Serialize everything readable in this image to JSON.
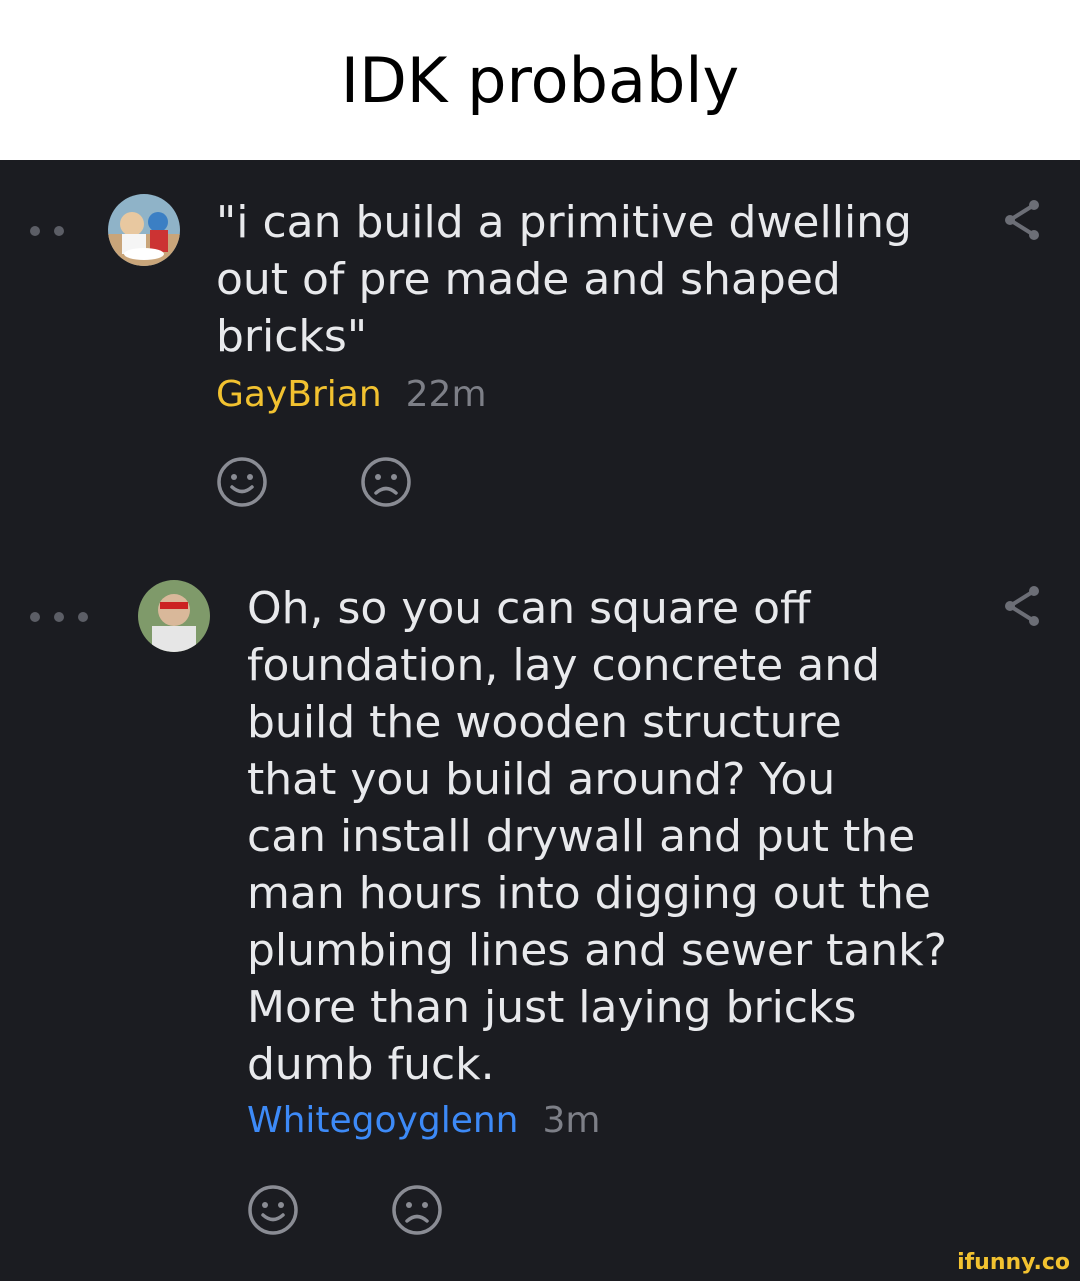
{
  "caption": "IDK probably",
  "comments": [
    {
      "text": "\"i can build a primitive dwelling\nout of pre made and shaped\nbricks\"",
      "username": "GayBrian",
      "time": "22m",
      "username_color": "#f2c230"
    },
    {
      "text": "Oh, so you can square off\nfoundation, lay concrete and\nbuild the wooden structure\nthat you build around? You\ncan install drywall and put the\nman hours into digging out the\nplumbing lines and sewer tank?\nMore than just laying bricks\ndumb fuck.",
      "username": "Whitegoyglenn",
      "time": "3m",
      "username_color": "#3d8af7"
    }
  ],
  "icons": [
    "thread-dots-icon",
    "avatar",
    "share-icon",
    "smile-icon",
    "frown-icon"
  ],
  "watermark": "ifunny.co"
}
